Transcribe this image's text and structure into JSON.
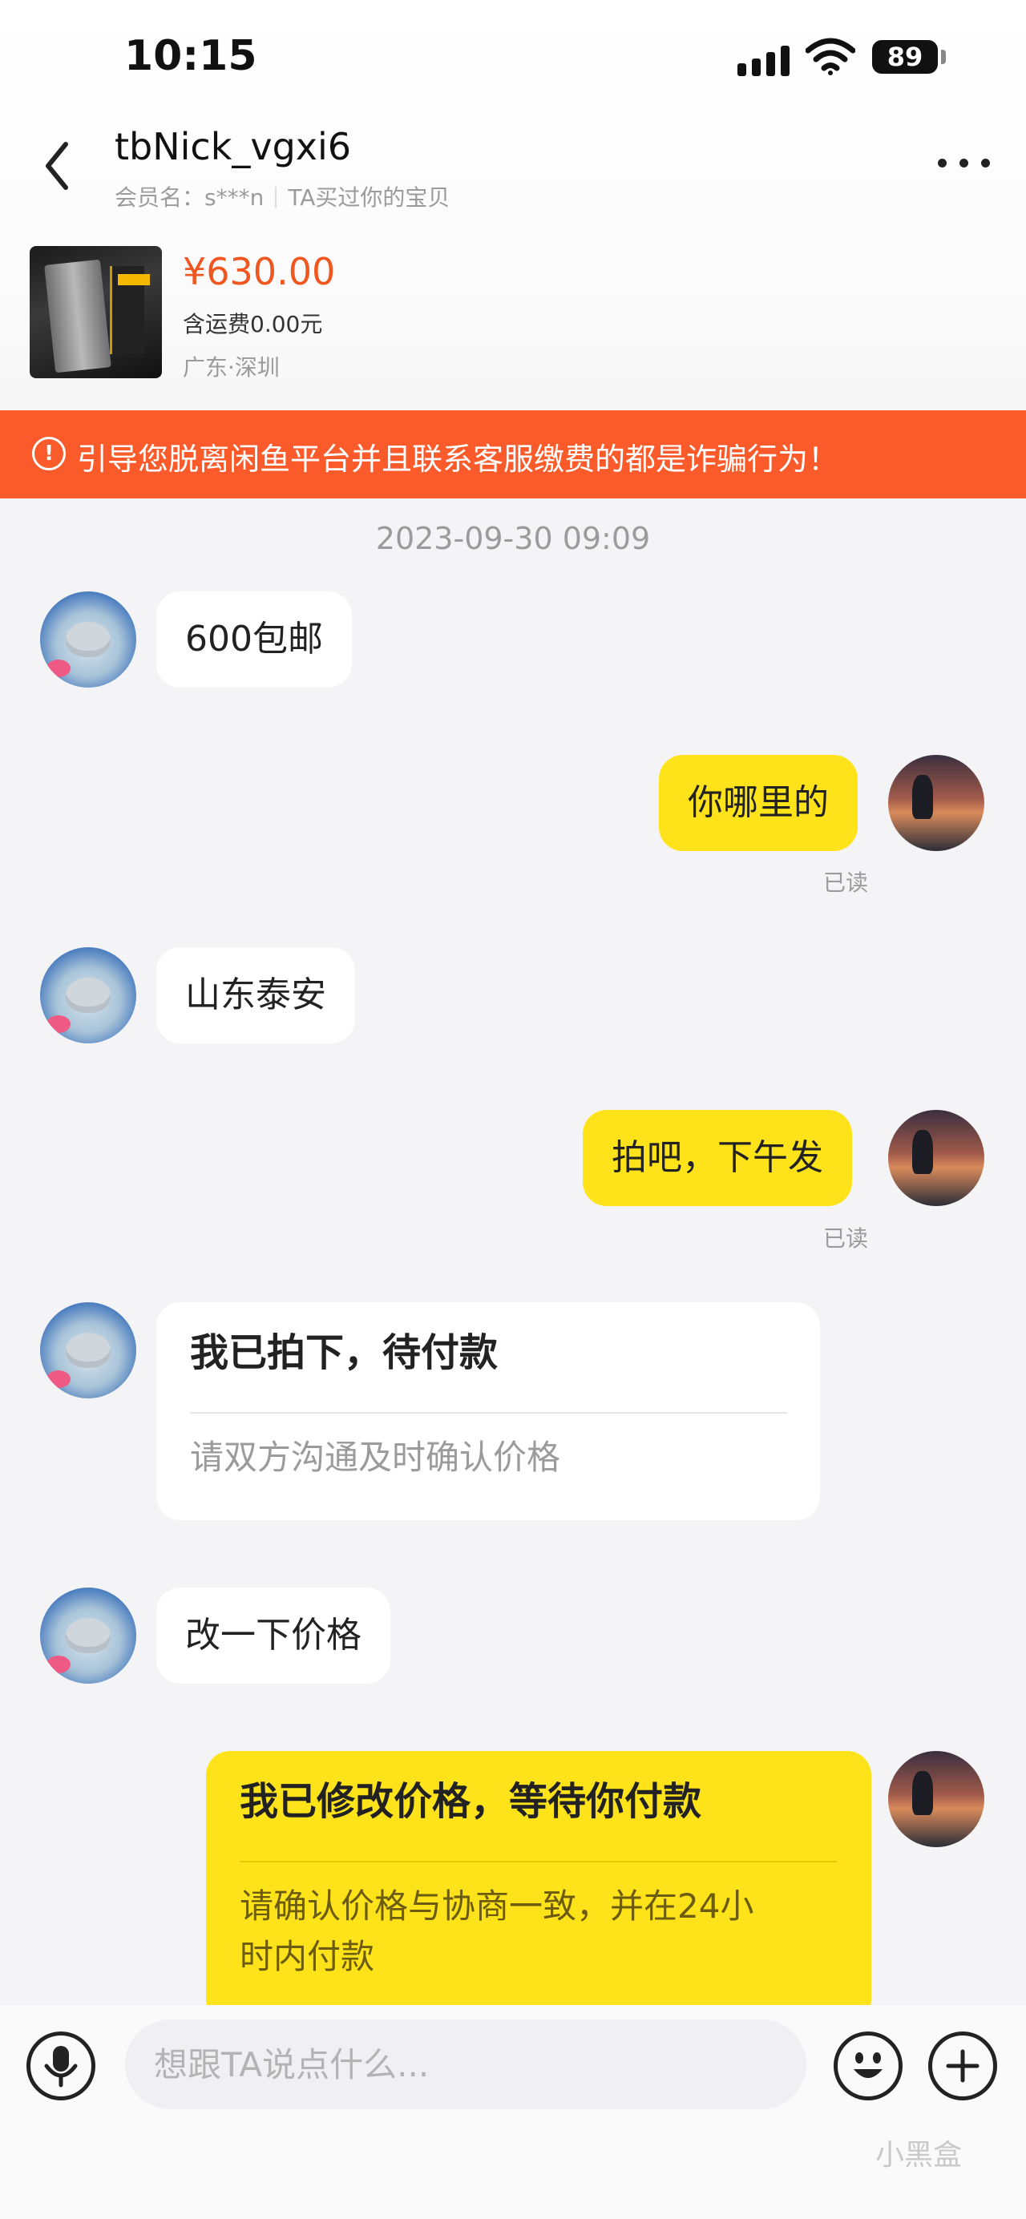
{
  "status_bar": {
    "time": "10:15",
    "battery": "89",
    "icons": [
      "signal-icon",
      "wifi-icon",
      "battery-icon"
    ]
  },
  "header": {
    "nickname": "tbNick_vgxi6",
    "member_label": "会员名：s***n",
    "bought_label": "TA买过你的宝贝",
    "icons": [
      "back-arrow-icon",
      "more-dots-icon"
    ]
  },
  "product": {
    "price": "¥630.00",
    "shipping": "含运费0.00元",
    "location": "广东·深圳"
  },
  "warning": {
    "text": "引导您脱离闲鱼平台并且联系客服缴费的都是诈骗行为！",
    "icon": "alert-circle-icon"
  },
  "colors": {
    "warning_bg": "#fb5b2b",
    "price": "#f0561f",
    "own_bubble": "#ffe31a",
    "other_bubble": "#ffffff"
  },
  "chat": {
    "timestamp": "2023-09-30 09:09",
    "messages": [
      {
        "from": "other",
        "text": "600包邮"
      },
      {
        "from": "me",
        "text": "你哪里的",
        "read": "已读"
      },
      {
        "from": "other",
        "text": "山东泰安"
      },
      {
        "from": "me",
        "text": "拍吧，下午发",
        "read": "已读"
      },
      {
        "from": "other",
        "card_title": "我已拍下，待付款",
        "card_sub": "请双方沟通及时确认价格"
      },
      {
        "from": "other",
        "text": "改一下价格"
      },
      {
        "from": "me",
        "card_title": "我已修改价格，等待你付款",
        "card_sub_line1": "请确认价格与协商一致，并在24小",
        "card_sub_line2": "时内付款"
      }
    ]
  },
  "input_bar": {
    "placeholder": "想跟TA说点什么...",
    "icons": [
      "microphone-icon",
      "emoji-icon",
      "plus-icon"
    ]
  },
  "watermark": "小黑盒"
}
